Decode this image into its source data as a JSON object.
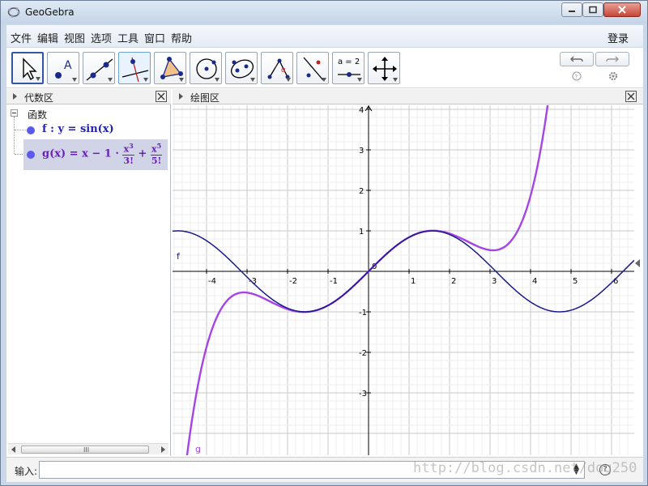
{
  "window": {
    "title": "GeoGebra"
  },
  "menu": {
    "items": [
      "文件",
      "编辑",
      "视图",
      "选项",
      "工具",
      "窗口",
      "帮助"
    ],
    "login": "登录"
  },
  "toolbar": {
    "tools": [
      "move-tool",
      "point-tool",
      "line-tool",
      "perpendicular-tool",
      "polygon-tool",
      "circle-tool",
      "ellipse-tool",
      "angle-tool",
      "reflect-tool",
      "slider-tool",
      "move-view-tool"
    ],
    "slider_label": "a = 2"
  },
  "algebra": {
    "title": "代数区",
    "group": "函数",
    "f": "f : y = sin(x)",
    "g_prefix": "g(x) = x − 1 ·",
    "g_num1": "x",
    "g_sup1": "3",
    "g_den1": "3!",
    "g_plus": "+",
    "g_num2": "x",
    "g_sup2": "5",
    "g_den2": "5!",
    "scroll_grip": "III"
  },
  "graphics": {
    "title": "绘图区",
    "x_ticks": [
      "-4",
      "-3",
      "-2",
      "-1",
      "0",
      "1",
      "2",
      "3",
      "4",
      "5",
      "6"
    ],
    "y_ticks": [
      "4",
      "3",
      "2",
      "1",
      "-1",
      "-2",
      "-3"
    ],
    "label_f": "f",
    "label_g": "g",
    "colors": {
      "f": "#1a1a8c",
      "g": "#a545e6",
      "grid": "#d6d6d6",
      "axis": "#000000"
    }
  },
  "inputbar": {
    "label": "输入:",
    "value": "",
    "help": "?"
  },
  "watermark": "http://blog.csdn.net/dog250"
}
